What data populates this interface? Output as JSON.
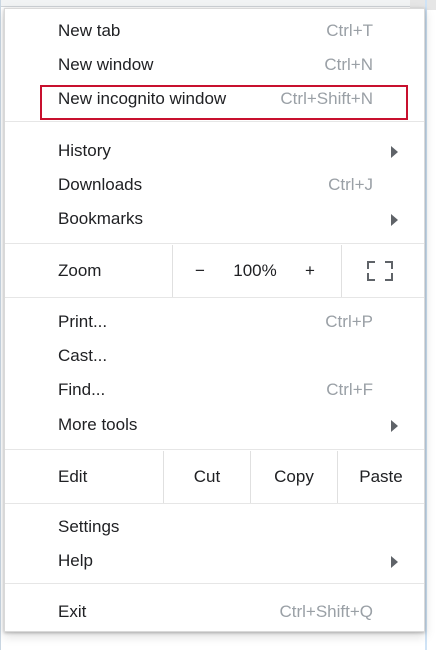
{
  "menu": {
    "new_tab": {
      "label": "New tab",
      "shortcut": "Ctrl+T"
    },
    "new_window": {
      "label": "New window",
      "shortcut": "Ctrl+N"
    },
    "new_incognito": {
      "label": "New incognito window",
      "shortcut": "Ctrl+Shift+N"
    },
    "history": {
      "label": "History"
    },
    "downloads": {
      "label": "Downloads",
      "shortcut": "Ctrl+J"
    },
    "bookmarks": {
      "label": "Bookmarks"
    },
    "zoom": {
      "label": "Zoom",
      "minus": "−",
      "value": "100%",
      "plus": "+"
    },
    "print": {
      "label": "Print...",
      "shortcut": "Ctrl+P"
    },
    "cast": {
      "label": "Cast..."
    },
    "find": {
      "label": "Find...",
      "shortcut": "Ctrl+F"
    },
    "more_tools": {
      "label": "More tools"
    },
    "edit": {
      "label": "Edit",
      "cut": "Cut",
      "copy": "Copy",
      "paste": "Paste"
    },
    "settings": {
      "label": "Settings"
    },
    "help": {
      "label": "Help"
    },
    "exit": {
      "label": "Exit",
      "shortcut": "Ctrl+Shift+Q"
    }
  },
  "annotation": {
    "highlight_color": "#c8102e",
    "highlighted_item": "new_incognito"
  },
  "colors": {
    "shortcut_gray": "#9aa0a6",
    "text": "#202124",
    "separator": "#e6e6e6"
  },
  "icons": {
    "submenu_arrow": "triangle-right",
    "fullscreen": "fullscreen-corners"
  }
}
